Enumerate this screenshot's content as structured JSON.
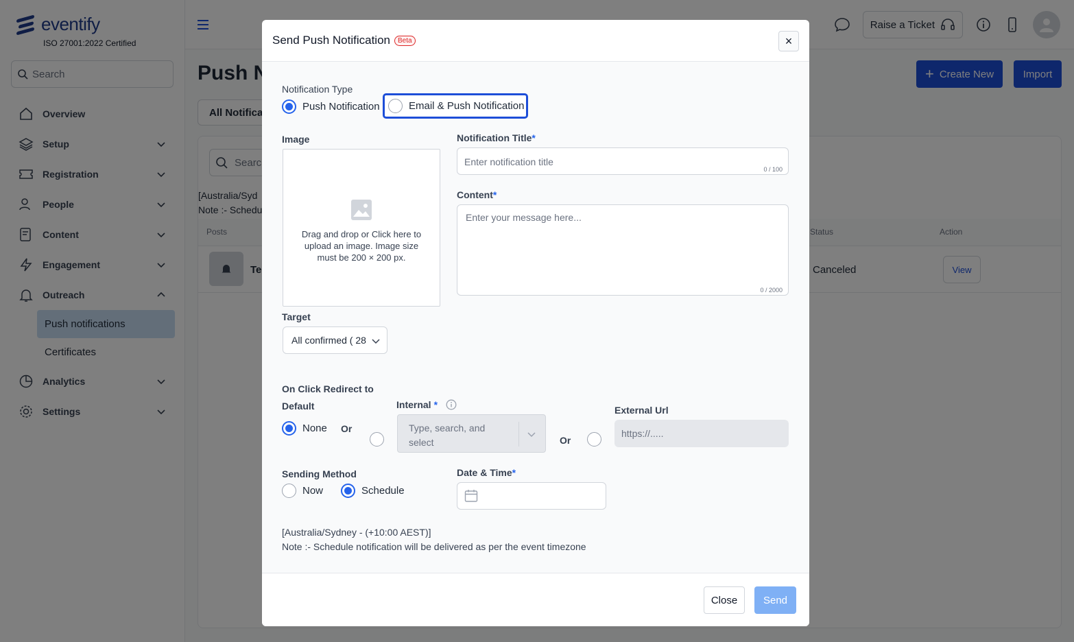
{
  "brand": {
    "name": "eventify",
    "certification": "ISO 27001:2022 Certified"
  },
  "sidebar": {
    "search_placeholder": "Search",
    "items": [
      {
        "label": "Overview",
        "icon": "home-icon"
      },
      {
        "label": "Setup",
        "icon": "layers-icon"
      },
      {
        "label": "Registration",
        "icon": "ticket-icon"
      },
      {
        "label": "People",
        "icon": "people-icon"
      },
      {
        "label": "Content",
        "icon": "content-icon"
      },
      {
        "label": "Engagement",
        "icon": "bolt-icon"
      },
      {
        "label": "Outreach",
        "icon": "bell-icon"
      },
      {
        "label": "Analytics",
        "icon": "pie-chart-icon"
      },
      {
        "label": "Settings",
        "icon": "gear-icon"
      }
    ],
    "outreach_sub": [
      "Push notifications",
      "Certificates"
    ]
  },
  "topbar": {
    "raise_ticket": "Raise a Ticket"
  },
  "page": {
    "title": "Push N",
    "create_new": "Create New",
    "import": "Import",
    "tab": "All Notificat",
    "table_search": "Searc",
    "tz_line1": "[Australia/Syd",
    "tz_line2": "Note :- Schedu",
    "columns": {
      "posts": "Posts",
      "status": "Status",
      "action": "Action"
    },
    "row": {
      "post": "Te",
      "status": "Canceled",
      "action": "View"
    }
  },
  "modal": {
    "title": "Send Push Notification",
    "badge": "Beta",
    "close_x": "×",
    "notification_type": {
      "label": "Notification Type",
      "options": [
        "Push Notification",
        "Email & Push Notification"
      ],
      "selected": "Push Notification"
    },
    "image": {
      "label": "Image",
      "hint": "Drag and drop or Click here to upload an image. Image size must be 200 × 200 px."
    },
    "title_field": {
      "label": "Notification Title",
      "required_mark": "*",
      "placeholder": "Enter notification title",
      "counter": "0 / 100"
    },
    "content_field": {
      "label": "Content",
      "required_mark": "*",
      "placeholder": "Enter your message here...",
      "counter": "0 / 2000"
    },
    "target": {
      "label": "Target",
      "value": "All confirmed ( 28"
    },
    "redirect": {
      "label": "On Click Redirect to",
      "default_label": "Default",
      "none": "None",
      "or1": "Or",
      "internal_label": "Internal",
      "required_mark": "*",
      "internal_placeholder": "Type, search, and select",
      "or2": "Or",
      "external_label": "External Url",
      "external_placeholder": "https://....."
    },
    "sending": {
      "label": "Sending Method",
      "options": [
        "Now",
        "Schedule"
      ],
      "selected": "Schedule"
    },
    "date_time": {
      "label": "Date & Time",
      "required_mark": "*",
      "value": ""
    },
    "timezone": "[Australia/Sydney - (+10:00 AEST)]",
    "note": "Note :- Schedule notification will be delivered as per the event timezone",
    "buttons": {
      "close": "Close",
      "send": "Send"
    }
  },
  "colors": {
    "brand": "#1e3a8a",
    "primary": "#1d4ed8",
    "radio": "#2563eb",
    "send_disabled": "#7fb0f5",
    "active_nav": "#c7ddf3"
  }
}
